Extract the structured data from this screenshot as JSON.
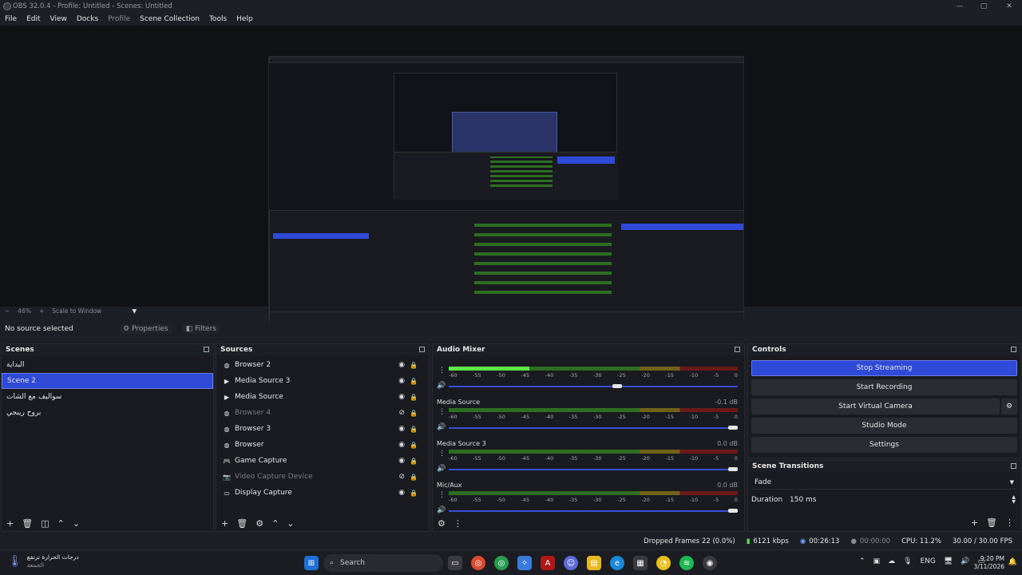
{
  "window": {
    "title": "OBS 32.0.4 - Profile: Untitled - Scenes: Untitled"
  },
  "menu": [
    "File",
    "Edit",
    "View",
    "Docks",
    "Profile",
    "Scene Collection",
    "Tools",
    "Help"
  ],
  "zoom": {
    "minus": "−",
    "level": "46%",
    "plus": "+",
    "mode": "Scale to Window"
  },
  "source_bar": {
    "no_source": "No source selected",
    "properties": "Properties",
    "filters": "Filters"
  },
  "scenes": {
    "title": "Scenes",
    "items": [
      "البداية",
      "Scene 2",
      "سواليف مع الشات",
      "بروح ريبجي"
    ],
    "active_index": 1
  },
  "sources": {
    "title": "Sources",
    "items": [
      {
        "name": "Browser 2",
        "icon": "globe-icon",
        "hidden": false
      },
      {
        "name": "Media Source 3",
        "icon": "play-icon",
        "hidden": false
      },
      {
        "name": "Media Source",
        "icon": "play-icon",
        "hidden": false
      },
      {
        "name": "Browser 4",
        "icon": "globe-icon",
        "hidden": true
      },
      {
        "name": "Browser 3",
        "icon": "globe-icon",
        "hidden": false
      },
      {
        "name": "Browser",
        "icon": "globe-icon",
        "hidden": false
      },
      {
        "name": "Game Capture",
        "icon": "gamepad-icon",
        "hidden": false
      },
      {
        "name": "Video Capture Device",
        "icon": "camera-icon",
        "hidden": true
      },
      {
        "name": "Display Capture",
        "icon": "monitor-icon",
        "hidden": false
      }
    ]
  },
  "mixer": {
    "title": "Audio Mixer",
    "ticks": [
      "-60",
      "-55",
      "-50",
      "-45",
      "-40",
      "-35",
      "-30",
      "-25",
      "-20",
      "-15",
      "-10",
      "-5",
      "0"
    ],
    "channels": [
      {
        "name": "",
        "db": "",
        "level": 0.28,
        "volume": 0.6
      },
      {
        "name": "Media Source",
        "db": "-0.1 dB",
        "level": 0.0,
        "volume": 1.0
      },
      {
        "name": "Media Source 3",
        "db": "0.0 dB",
        "level": 0.0,
        "volume": 1.0
      },
      {
        "name": "Mic/Aux",
        "db": "0.0 dB",
        "level": 0.0,
        "volume": 1.0
      }
    ]
  },
  "controls": {
    "title": "Controls",
    "buttons": [
      "Stop Streaming",
      "Start Recording",
      "Start Virtual Camera",
      "Studio Mode",
      "Settings"
    ]
  },
  "transitions": {
    "title": "Scene Transitions",
    "selected": "Fade",
    "duration_label": "Duration",
    "duration_value": "150 ms"
  },
  "status": {
    "dropped": "Dropped Frames 22 (0.0%)",
    "bitrate": "6121 kbps",
    "stream_time": "00:26:13",
    "rec_time": "00:00:00",
    "cpu": "CPU: 11.2%",
    "fps": "30.00 / 30.00 FPS"
  },
  "taskbar": {
    "weather_line1": "درجات الحرارة ترتفع",
    "weather_line2": "الجمعة",
    "search": "Search",
    "lang": "ENG",
    "time": "9:20 PM",
    "date": "3/11/2026"
  }
}
